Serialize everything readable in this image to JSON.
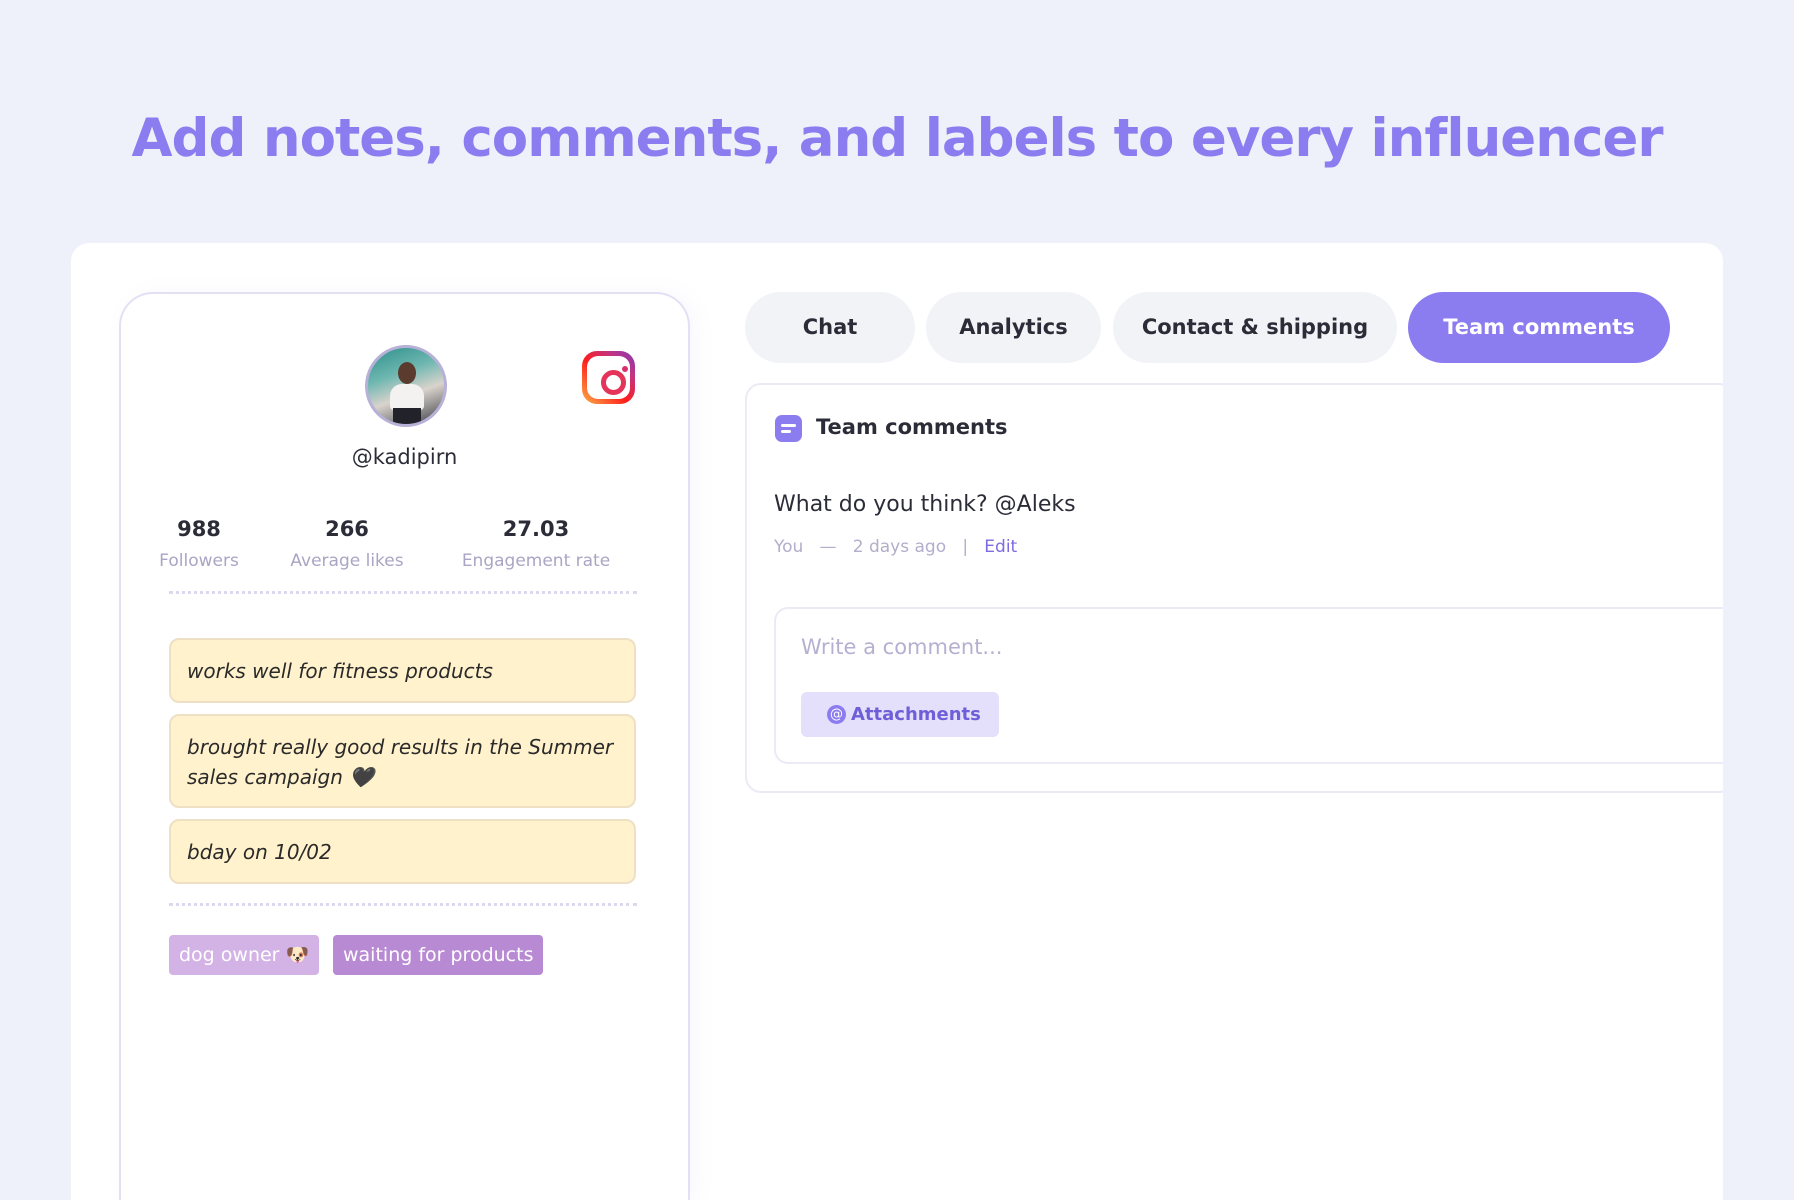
{
  "headline": "Add notes, comments, and labels to every influencer",
  "profile": {
    "handle": "@kadipirn",
    "platform_icon": "instagram-icon",
    "stats": [
      {
        "value": "988",
        "label": "Followers"
      },
      {
        "value": "266",
        "label": "Average likes"
      },
      {
        "value": "27.03",
        "label": "Engagement rate"
      }
    ],
    "notes": [
      "works well for fitness products",
      "brought really good results in the Summer sales campaign 🖤",
      "bday on 10/02"
    ],
    "labels": [
      {
        "text": "dog owner 🐶",
        "color": "#d3b3e6"
      },
      {
        "text": "waiting for products",
        "color": "#b98ad4"
      }
    ]
  },
  "tabs": [
    {
      "label": "Chat"
    },
    {
      "label": "Analytics"
    },
    {
      "label": "Contact & shipping"
    },
    {
      "label": "Team comments",
      "active": true
    }
  ],
  "comments": {
    "title": "Team comments",
    "items": [
      {
        "text": "What do you think? @Aleks",
        "author": "You",
        "separator": "—",
        "time": "2 days ago",
        "divider": "|",
        "action": "Edit"
      }
    ],
    "composer": {
      "placeholder": "Write a comment...",
      "attach_label": "Attachments"
    }
  },
  "colors": {
    "accent": "#8b7cf0",
    "background": "#eef1f9",
    "note_bg": "#fff2cc"
  }
}
